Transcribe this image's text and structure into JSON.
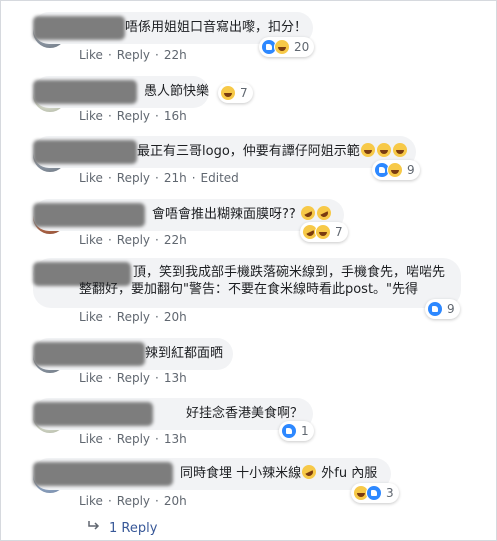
{
  "comments": [
    {
      "text": "唔係用姐姐口音寫出嚟，扣分！",
      "time": "22h",
      "reactions": [
        "like",
        "haha"
      ],
      "count": "20",
      "edited": ""
    },
    {
      "text": "愚人節快樂",
      "time": "16h",
      "reactions": [
        "haha"
      ],
      "count": "7",
      "edited": ""
    },
    {
      "text": "最正有三哥logo，仲要有譚仔阿姐示範",
      "time": "21h",
      "edited": "Edited",
      "reactions": [
        "like",
        "haha"
      ],
      "count": "9"
    },
    {
      "text": "會唔會推出糊辣面膜呀??",
      "time": "22h",
      "reactions": [
        "rofl",
        "haha"
      ],
      "count": "7",
      "edited": ""
    },
    {
      "text": "頂，笑到我成部手機跌落碗米線到，手機食先，啱啱先整翻好，要加翻句\"警告：不要在食米線時看此post。\"先得",
      "time": "20h",
      "reactions": [
        "like"
      ],
      "count": "9",
      "edited": ""
    },
    {
      "text": "辣到紅都面晒",
      "time": "13h",
      "edited": ""
    },
    {
      "text": "好挂念香港美食啊？",
      "time": "13h",
      "reactions": [
        "like"
      ],
      "count": "1",
      "edited": ""
    },
    {
      "text": "同時食埋 十小辣米線",
      "text_after": "外fu 內服",
      "time": "20h",
      "reactions": [
        "haha",
        "like"
      ],
      "count": "3",
      "edited": ""
    }
  ],
  "labels": {
    "like": "Like",
    "reply": "Reply",
    "dot": "·"
  },
  "more_replies": "1 Reply",
  "colors": {
    "link": "#385898",
    "bubble": "#f2f3f5",
    "meta": "#606770"
  }
}
